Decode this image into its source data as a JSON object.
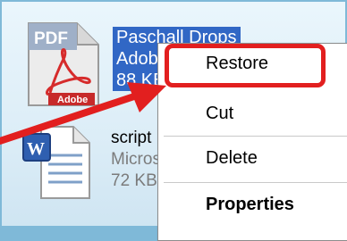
{
  "files": [
    {
      "name": "Paschall Drops",
      "type": "Adobe",
      "size": "88 KB",
      "selected": true,
      "icon": "pdf-file-icon",
      "icon_label": "PDF",
      "icon_brand": "Adobe"
    },
    {
      "name": "script",
      "type": "Microso",
      "size": "72 KB",
      "selected": false,
      "icon": "word-file-icon"
    }
  ],
  "context_menu": {
    "items": [
      {
        "label": "Restore",
        "bold": false
      },
      {
        "label": "Cut",
        "bold": false
      },
      {
        "label": "Delete",
        "bold": false
      },
      {
        "label": "Properties",
        "bold": true
      }
    ]
  },
  "colors": {
    "selection": "#3167c5",
    "highlight": "#e21f1f"
  }
}
